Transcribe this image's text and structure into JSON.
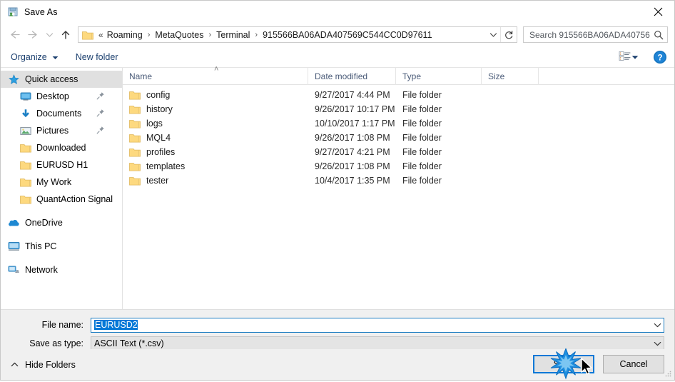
{
  "window": {
    "title": "Save As",
    "app_icon": "save-as-icon",
    "close_label": "✕"
  },
  "navigation": {
    "back_icon": "arrow-left-icon",
    "forward_icon": "arrow-right-icon",
    "recent_icon": "chevron-down-icon",
    "up_icon": "arrow-up-icon",
    "breadcrumb_prefix": "«",
    "breadcrumbs": [
      "Roaming",
      "MetaQuotes",
      "Terminal",
      "915566BA06ADA407569C544CC0D97611"
    ],
    "separator": "›",
    "dropdown_icon": "chevron-down-icon",
    "refresh_icon": "refresh-icon"
  },
  "search": {
    "placeholder": "Search 915566BA06ADA40756...",
    "icon": "search-icon"
  },
  "toolbar": {
    "organize_label": "Organize",
    "organize_caret": "▾",
    "new_folder_label": "New folder",
    "view_icon": "view-layout-icon",
    "view_caret": "▾",
    "help_icon": "help-icon",
    "help_glyph": "?"
  },
  "sidebar": {
    "items": [
      {
        "label": "Quick access",
        "icon": "star-icon",
        "selected": true,
        "indent": false,
        "pinned": false
      },
      {
        "label": "Desktop",
        "icon": "desktop-icon",
        "selected": false,
        "indent": true,
        "pinned": true
      },
      {
        "label": "Documents",
        "icon": "documents-download-icon",
        "selected": false,
        "indent": true,
        "pinned": true
      },
      {
        "label": "Pictures",
        "icon": "pictures-icon",
        "selected": false,
        "indent": true,
        "pinned": true
      },
      {
        "label": "Downloaded",
        "icon": "folder-icon",
        "selected": false,
        "indent": true,
        "pinned": false
      },
      {
        "label": "EURUSD H1",
        "icon": "folder-icon",
        "selected": false,
        "indent": true,
        "pinned": false
      },
      {
        "label": "My Work",
        "icon": "folder-icon",
        "selected": false,
        "indent": true,
        "pinned": false
      },
      {
        "label": "QuantAction Signal",
        "icon": "folder-icon",
        "selected": false,
        "indent": true,
        "pinned": false
      }
    ],
    "groups": [
      {
        "label": "OneDrive",
        "icon": "onedrive-cloud-icon"
      },
      {
        "label": "This PC",
        "icon": "this-pc-icon"
      },
      {
        "label": "Network",
        "icon": "network-icon"
      }
    ]
  },
  "filelist": {
    "columns": [
      "Name",
      "Date modified",
      "Type",
      "Size"
    ],
    "sort_indicator": "˄",
    "rows": [
      {
        "name": "config",
        "date": "9/27/2017 4:44 PM",
        "type": "File folder",
        "size": ""
      },
      {
        "name": "history",
        "date": "9/26/2017 10:17 PM",
        "type": "File folder",
        "size": ""
      },
      {
        "name": "logs",
        "date": "10/10/2017 1:17 PM",
        "type": "File folder",
        "size": ""
      },
      {
        "name": "MQL4",
        "date": "9/26/2017 1:08 PM",
        "type": "File folder",
        "size": ""
      },
      {
        "name": "profiles",
        "date": "9/27/2017 4:21 PM",
        "type": "File folder",
        "size": ""
      },
      {
        "name": "templates",
        "date": "9/26/2017 1:08 PM",
        "type": "File folder",
        "size": ""
      },
      {
        "name": "tester",
        "date": "10/4/2017 1:35 PM",
        "type": "File folder",
        "size": ""
      }
    ]
  },
  "form": {
    "filename_label": "File name:",
    "filename_value": "EURUSD2",
    "filetype_label": "Save as type:",
    "filetype_value": "ASCII Text (*.csv)",
    "dropdown_icon": "chevron-down-icon"
  },
  "footer": {
    "hide_folders_label": "Hide Folders",
    "hide_folders_icon": "chevron-up-icon",
    "save_label": "Save",
    "cancel_label": "Cancel",
    "resize_grip_icon": "resize-grip-icon",
    "click_burst_icon": "click-burst-icon",
    "cursor_icon": "mouse-pointer-icon"
  },
  "colors": {
    "accent": "#0078d7",
    "folder_yellow": "#fdd97f",
    "command_blue": "#1b3f6e",
    "header_text": "#4a5b78",
    "selection_blue": "#0078d7"
  }
}
